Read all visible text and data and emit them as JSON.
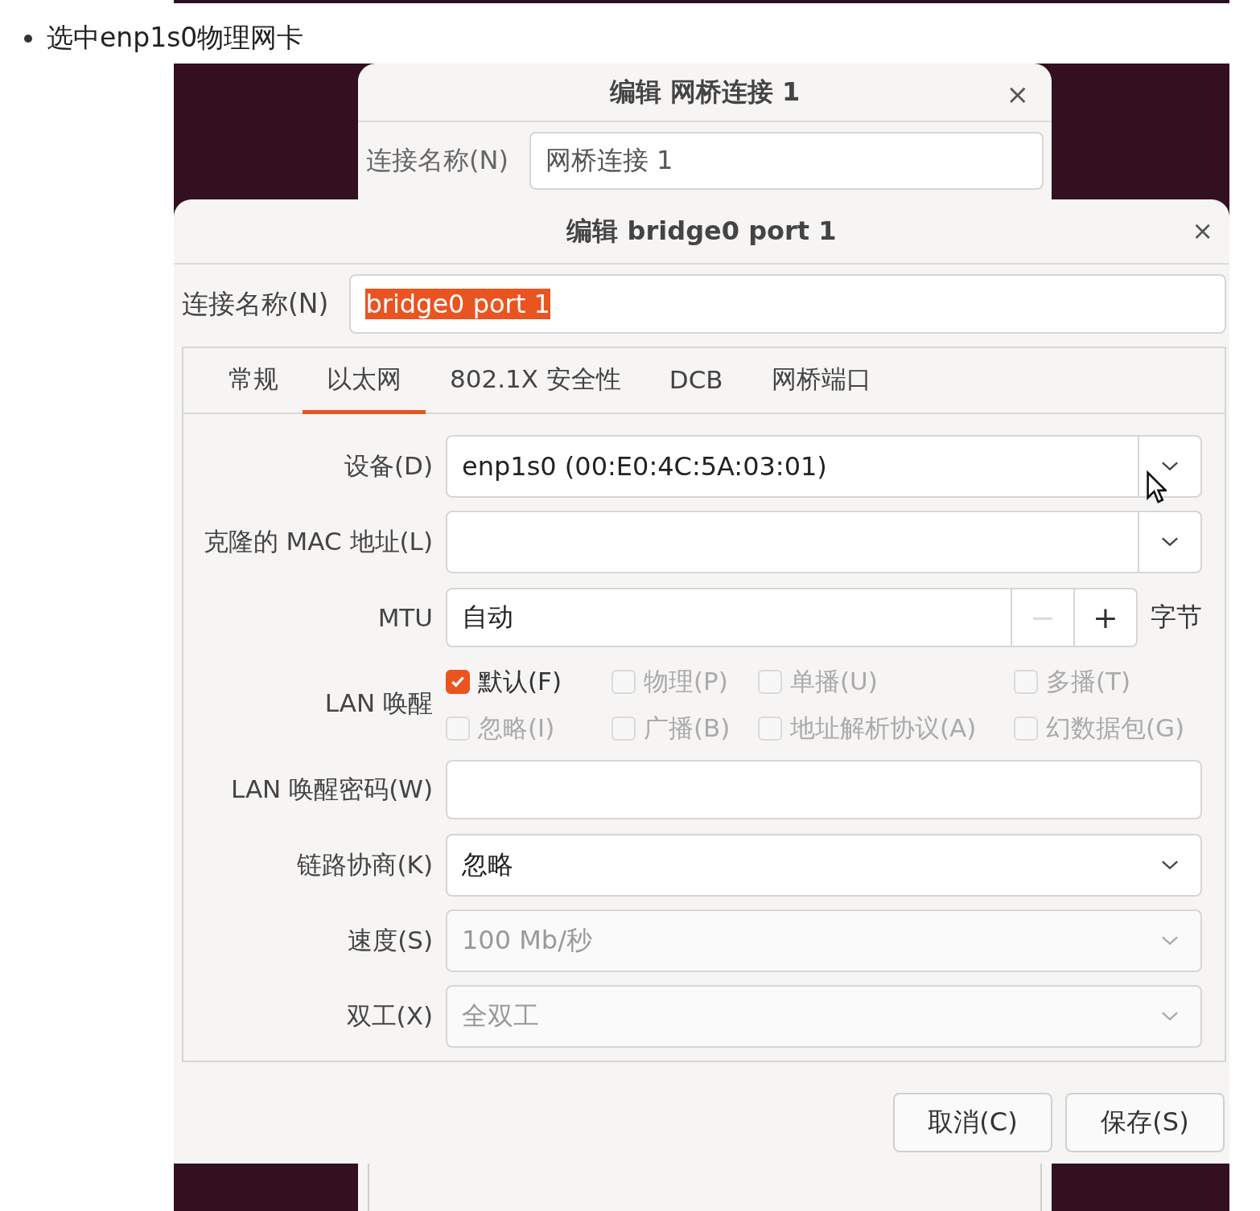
{
  "bullet": {
    "text": "选中enp1s0物理网卡"
  },
  "back_dialog": {
    "title": "编辑 网桥连接 1",
    "close": "×",
    "name_label": "连接名称(N)",
    "name_value": "网桥连接 1"
  },
  "dialog": {
    "title": "编辑 bridge0 port 1",
    "close": "×",
    "name_label": "连接名称(N)",
    "name_value": "bridge0 port 1",
    "name_selected": true,
    "tabs": [
      {
        "label": "常规",
        "selected": false
      },
      {
        "label": "以太网",
        "selected": true
      },
      {
        "label": "802.1X 安全性",
        "selected": false
      },
      {
        "label": "DCB",
        "selected": false
      },
      {
        "label": "网桥端口",
        "selected": false
      }
    ],
    "fields": [
      {
        "kind": "combo",
        "label": "设备(D)",
        "value": "enp1s0 (00:E0:4C:5A:03:01)",
        "disabled": false,
        "split": true,
        "cursor": true
      },
      {
        "kind": "combo",
        "label": "克隆的 MAC 地址(L)",
        "disabled": false,
        "split": true
      },
      {
        "kind": "spin",
        "label": "MTU",
        "value": "自动",
        "minus": "−",
        "minus_disabled": true,
        "plus": "+",
        "unit": "字节"
      },
      {
        "kind": "checks",
        "label": "LAN 唤醒",
        "options": [
          {
            "label": "默认(F)",
            "checked": true,
            "disabled": false
          },
          {
            "label": "物理(P)",
            "checked": false,
            "disabled": true
          },
          {
            "label": "单播(U)",
            "checked": false,
            "disabled": true
          },
          {
            "label": "多播(T)",
            "checked": false,
            "disabled": true
          },
          {
            "label": "忽略(I)",
            "checked": false,
            "disabled": true
          },
          {
            "label": "广播(B)",
            "checked": false,
            "disabled": true
          },
          {
            "label": "地址解析协议(A)",
            "checked": false,
            "disabled": true
          },
          {
            "label": "幻数据包(G)",
            "checked": false,
            "disabled": true
          }
        ]
      },
      {
        "kind": "entry",
        "label": "LAN 唤醒密码(W)"
      },
      {
        "kind": "combo",
        "label": "链路协商(K)",
        "value": "忽略",
        "disabled": false,
        "split": false
      },
      {
        "kind": "combo",
        "label": "速度(S)",
        "value": "100 Mb/秒",
        "disabled": true,
        "split": false
      },
      {
        "kind": "combo",
        "label": "双工(X)",
        "value": "全双工",
        "disabled": true,
        "split": false
      }
    ],
    "buttons": [
      "取消(C)",
      "保存(S)"
    ]
  }
}
